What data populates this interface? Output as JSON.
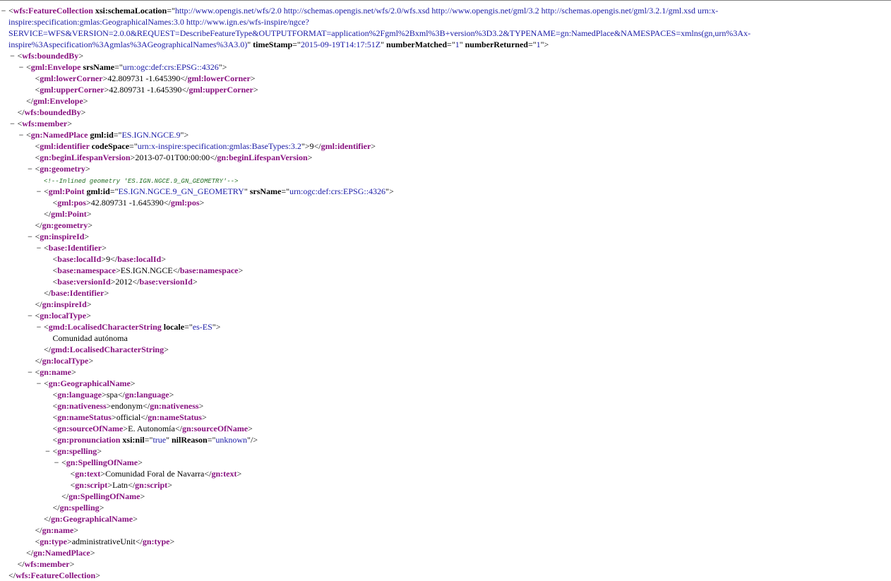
{
  "toggle_symbol": "−",
  "colors": {
    "tag": "#881280",
    "attr_value": "#1a1aa6",
    "comment": "#236e25",
    "text": "#000000"
  },
  "lines": [
    {
      "d": 0,
      "toggle": true,
      "wrap": true,
      "parts": [
        {
          "k": "lt",
          "t": "<"
        },
        {
          "k": "tag",
          "t": "wfs:FeatureCollection"
        },
        {
          "k": "an",
          "t": " xsi:schemaLocation"
        },
        {
          "k": "p",
          "t": "=\""
        },
        {
          "k": "av",
          "t": "http://www.opengis.net/wfs/2.0 http://schemas.opengis.net/wfs/2.0/wfs.xsd http://www.opengis.net/gml/3.2 http://schemas.opengis.net/gml/3.2.1/gml.xsd urn:x-inspire:specification:gmlas:GeographicalNames:3.0 http://www.ign.es/wfs-inspire/ngce?SERVICE=WFS&VERSION=2.0.0&REQUEST=DescribeFeatureType&OUTPUTFORMAT=application%2Fgml%2Bxml%3B+version%3D3.2&TYPENAME=gn:NamedPlace&NAMESPACES=xmlns(gn,urn%3Ax-inspire%3Aspecification%3Agmlas%3AGeographicalNames%3A3.0)"
        },
        {
          "k": "p",
          "t": "\""
        },
        {
          "k": "an",
          "t": " timeStamp"
        },
        {
          "k": "p",
          "t": "=\""
        },
        {
          "k": "av",
          "t": "2015-09-19T14:17:51Z"
        },
        {
          "k": "p",
          "t": "\""
        },
        {
          "k": "an",
          "t": " numberMatched"
        },
        {
          "k": "p",
          "t": "=\""
        },
        {
          "k": "av",
          "t": "1"
        },
        {
          "k": "p",
          "t": "\""
        },
        {
          "k": "an",
          "t": " numberReturned"
        },
        {
          "k": "p",
          "t": "=\""
        },
        {
          "k": "av",
          "t": "1"
        },
        {
          "k": "p",
          "t": "\""
        },
        {
          "k": "lt",
          "t": ">"
        }
      ]
    },
    {
      "d": 1,
      "toggle": true,
      "parts": [
        {
          "k": "lt",
          "t": "<"
        },
        {
          "k": "tag",
          "t": "wfs:boundedBy"
        },
        {
          "k": "lt",
          "t": ">"
        }
      ]
    },
    {
      "d": 2,
      "toggle": true,
      "parts": [
        {
          "k": "lt",
          "t": "<"
        },
        {
          "k": "tag",
          "t": "gml:Envelope"
        },
        {
          "k": "an",
          "t": " srsName"
        },
        {
          "k": "p",
          "t": "=\""
        },
        {
          "k": "av",
          "t": "urn:ogc:def:crs:EPSG::4326"
        },
        {
          "k": "p",
          "t": "\""
        },
        {
          "k": "lt",
          "t": ">"
        }
      ]
    },
    {
      "d": 3,
      "parts": [
        {
          "k": "lt",
          "t": "<"
        },
        {
          "k": "tag",
          "t": "gml:lowerCorner"
        },
        {
          "k": "lt",
          "t": ">"
        },
        {
          "k": "txt",
          "t": "42.809731 -1.645390"
        },
        {
          "k": "lt",
          "t": "</"
        },
        {
          "k": "tag",
          "t": "gml:lowerCorner"
        },
        {
          "k": "lt",
          "t": ">"
        }
      ]
    },
    {
      "d": 3,
      "parts": [
        {
          "k": "lt",
          "t": "<"
        },
        {
          "k": "tag",
          "t": "gml:upperCorner"
        },
        {
          "k": "lt",
          "t": ">"
        },
        {
          "k": "txt",
          "t": "42.809731 -1.645390"
        },
        {
          "k": "lt",
          "t": "</"
        },
        {
          "k": "tag",
          "t": "gml:upperCorner"
        },
        {
          "k": "lt",
          "t": ">"
        }
      ]
    },
    {
      "d": 2,
      "parts": [
        {
          "k": "lt",
          "t": "</"
        },
        {
          "k": "tag",
          "t": "gml:Envelope"
        },
        {
          "k": "lt",
          "t": ">"
        }
      ]
    },
    {
      "d": 1,
      "parts": [
        {
          "k": "lt",
          "t": "</"
        },
        {
          "k": "tag",
          "t": "wfs:boundedBy"
        },
        {
          "k": "lt",
          "t": ">"
        }
      ]
    },
    {
      "d": 1,
      "toggle": true,
      "parts": [
        {
          "k": "lt",
          "t": "<"
        },
        {
          "k": "tag",
          "t": "wfs:member"
        },
        {
          "k": "lt",
          "t": ">"
        }
      ]
    },
    {
      "d": 2,
      "toggle": true,
      "parts": [
        {
          "k": "lt",
          "t": "<"
        },
        {
          "k": "tag",
          "t": "gn:NamedPlace"
        },
        {
          "k": "an",
          "t": " gml:id"
        },
        {
          "k": "p",
          "t": "=\""
        },
        {
          "k": "av",
          "t": "ES.IGN.NGCE.9"
        },
        {
          "k": "p",
          "t": "\""
        },
        {
          "k": "lt",
          "t": ">"
        }
      ]
    },
    {
      "d": 3,
      "parts": [
        {
          "k": "lt",
          "t": "<"
        },
        {
          "k": "tag",
          "t": "gml:identifier"
        },
        {
          "k": "an",
          "t": " codeSpace"
        },
        {
          "k": "p",
          "t": "=\""
        },
        {
          "k": "av",
          "t": "urn:x-inspire:specification:gmlas:BaseTypes:3.2"
        },
        {
          "k": "p",
          "t": "\""
        },
        {
          "k": "lt",
          "t": ">"
        },
        {
          "k": "txt",
          "t": "9"
        },
        {
          "k": "lt",
          "t": "</"
        },
        {
          "k": "tag",
          "t": "gml:identifier"
        },
        {
          "k": "lt",
          "t": ">"
        }
      ]
    },
    {
      "d": 3,
      "parts": [
        {
          "k": "lt",
          "t": "<"
        },
        {
          "k": "tag",
          "t": "gn:beginLifespanVersion"
        },
        {
          "k": "lt",
          "t": ">"
        },
        {
          "k": "txt",
          "t": "2013-07-01T00:00:00"
        },
        {
          "k": "lt",
          "t": "</"
        },
        {
          "k": "tag",
          "t": "gn:beginLifespanVersion"
        },
        {
          "k": "lt",
          "t": ">"
        }
      ]
    },
    {
      "d": 3,
      "toggle": true,
      "parts": [
        {
          "k": "lt",
          "t": "<"
        },
        {
          "k": "tag",
          "t": "gn:geometry"
        },
        {
          "k": "lt",
          "t": ">"
        }
      ]
    },
    {
      "d": 4,
      "parts": [
        {
          "k": "com",
          "t": "<!--Inlined geometry 'ES.IGN.NGCE.9_GN_GEOMETRY'-->"
        }
      ]
    },
    {
      "d": 4,
      "toggle": true,
      "parts": [
        {
          "k": "lt",
          "t": "<"
        },
        {
          "k": "tag",
          "t": "gml:Point"
        },
        {
          "k": "an",
          "t": " gml:id"
        },
        {
          "k": "p",
          "t": "=\""
        },
        {
          "k": "av",
          "t": "ES.IGN.NGCE.9_GN_GEOMETRY"
        },
        {
          "k": "p",
          "t": "\""
        },
        {
          "k": "an",
          "t": " srsName"
        },
        {
          "k": "p",
          "t": "=\""
        },
        {
          "k": "av",
          "t": "urn:ogc:def:crs:EPSG::4326"
        },
        {
          "k": "p",
          "t": "\""
        },
        {
          "k": "lt",
          "t": ">"
        }
      ]
    },
    {
      "d": 5,
      "parts": [
        {
          "k": "lt",
          "t": "<"
        },
        {
          "k": "tag",
          "t": "gml:pos"
        },
        {
          "k": "lt",
          "t": ">"
        },
        {
          "k": "txt",
          "t": "42.809731 -1.645390"
        },
        {
          "k": "lt",
          "t": "</"
        },
        {
          "k": "tag",
          "t": "gml:pos"
        },
        {
          "k": "lt",
          "t": ">"
        }
      ]
    },
    {
      "d": 4,
      "parts": [
        {
          "k": "lt",
          "t": "</"
        },
        {
          "k": "tag",
          "t": "gml:Point"
        },
        {
          "k": "lt",
          "t": ">"
        }
      ]
    },
    {
      "d": 3,
      "parts": [
        {
          "k": "lt",
          "t": "</"
        },
        {
          "k": "tag",
          "t": "gn:geometry"
        },
        {
          "k": "lt",
          "t": ">"
        }
      ]
    },
    {
      "d": 3,
      "toggle": true,
      "parts": [
        {
          "k": "lt",
          "t": "<"
        },
        {
          "k": "tag",
          "t": "gn:inspireId"
        },
        {
          "k": "lt",
          "t": ">"
        }
      ]
    },
    {
      "d": 4,
      "toggle": true,
      "parts": [
        {
          "k": "lt",
          "t": "<"
        },
        {
          "k": "tag",
          "t": "base:Identifier"
        },
        {
          "k": "lt",
          "t": ">"
        }
      ]
    },
    {
      "d": 5,
      "parts": [
        {
          "k": "lt",
          "t": "<"
        },
        {
          "k": "tag",
          "t": "base:localId"
        },
        {
          "k": "lt",
          "t": ">"
        },
        {
          "k": "txt",
          "t": "9"
        },
        {
          "k": "lt",
          "t": "</"
        },
        {
          "k": "tag",
          "t": "base:localId"
        },
        {
          "k": "lt",
          "t": ">"
        }
      ]
    },
    {
      "d": 5,
      "parts": [
        {
          "k": "lt",
          "t": "<"
        },
        {
          "k": "tag",
          "t": "base:namespace"
        },
        {
          "k": "lt",
          "t": ">"
        },
        {
          "k": "txt",
          "t": "ES.IGN.NGCE"
        },
        {
          "k": "lt",
          "t": "</"
        },
        {
          "k": "tag",
          "t": "base:namespace"
        },
        {
          "k": "lt",
          "t": ">"
        }
      ]
    },
    {
      "d": 5,
      "parts": [
        {
          "k": "lt",
          "t": "<"
        },
        {
          "k": "tag",
          "t": "base:versionId"
        },
        {
          "k": "lt",
          "t": ">"
        },
        {
          "k": "txt",
          "t": "2012"
        },
        {
          "k": "lt",
          "t": "</"
        },
        {
          "k": "tag",
          "t": "base:versionId"
        },
        {
          "k": "lt",
          "t": ">"
        }
      ]
    },
    {
      "d": 4,
      "parts": [
        {
          "k": "lt",
          "t": "</"
        },
        {
          "k": "tag",
          "t": "base:Identifier"
        },
        {
          "k": "lt",
          "t": ">"
        }
      ]
    },
    {
      "d": 3,
      "parts": [
        {
          "k": "lt",
          "t": "</"
        },
        {
          "k": "tag",
          "t": "gn:inspireId"
        },
        {
          "k": "lt",
          "t": ">"
        }
      ]
    },
    {
      "d": 3,
      "toggle": true,
      "parts": [
        {
          "k": "lt",
          "t": "<"
        },
        {
          "k": "tag",
          "t": "gn:localType"
        },
        {
          "k": "lt",
          "t": ">"
        }
      ]
    },
    {
      "d": 4,
      "toggle": true,
      "parts": [
        {
          "k": "lt",
          "t": "<"
        },
        {
          "k": "tag",
          "t": "gmd:LocalisedCharacterString"
        },
        {
          "k": "an",
          "t": " locale"
        },
        {
          "k": "p",
          "t": "=\""
        },
        {
          "k": "av",
          "t": "es-ES"
        },
        {
          "k": "p",
          "t": "\""
        },
        {
          "k": "lt",
          "t": ">"
        }
      ]
    },
    {
      "d": 5,
      "parts": [
        {
          "k": "txt",
          "t": "Comunidad autónoma"
        }
      ]
    },
    {
      "d": 4,
      "parts": [
        {
          "k": "lt",
          "t": "</"
        },
        {
          "k": "tag",
          "t": "gmd:LocalisedCharacterString"
        },
        {
          "k": "lt",
          "t": ">"
        }
      ]
    },
    {
      "d": 3,
      "parts": [
        {
          "k": "lt",
          "t": "</"
        },
        {
          "k": "tag",
          "t": "gn:localType"
        },
        {
          "k": "lt",
          "t": ">"
        }
      ]
    },
    {
      "d": 3,
      "toggle": true,
      "parts": [
        {
          "k": "lt",
          "t": "<"
        },
        {
          "k": "tag",
          "t": "gn:name"
        },
        {
          "k": "lt",
          "t": ">"
        }
      ]
    },
    {
      "d": 4,
      "toggle": true,
      "parts": [
        {
          "k": "lt",
          "t": "<"
        },
        {
          "k": "tag",
          "t": "gn:GeographicalName"
        },
        {
          "k": "lt",
          "t": ">"
        }
      ]
    },
    {
      "d": 5,
      "parts": [
        {
          "k": "lt",
          "t": "<"
        },
        {
          "k": "tag",
          "t": "gn:language"
        },
        {
          "k": "lt",
          "t": ">"
        },
        {
          "k": "txt",
          "t": "spa"
        },
        {
          "k": "lt",
          "t": "</"
        },
        {
          "k": "tag",
          "t": "gn:language"
        },
        {
          "k": "lt",
          "t": ">"
        }
      ]
    },
    {
      "d": 5,
      "parts": [
        {
          "k": "lt",
          "t": "<"
        },
        {
          "k": "tag",
          "t": "gn:nativeness"
        },
        {
          "k": "lt",
          "t": ">"
        },
        {
          "k": "txt",
          "t": "endonym"
        },
        {
          "k": "lt",
          "t": "</"
        },
        {
          "k": "tag",
          "t": "gn:nativeness"
        },
        {
          "k": "lt",
          "t": ">"
        }
      ]
    },
    {
      "d": 5,
      "parts": [
        {
          "k": "lt",
          "t": "<"
        },
        {
          "k": "tag",
          "t": "gn:nameStatus"
        },
        {
          "k": "lt",
          "t": ">"
        },
        {
          "k": "txt",
          "t": "official"
        },
        {
          "k": "lt",
          "t": "</"
        },
        {
          "k": "tag",
          "t": "gn:nameStatus"
        },
        {
          "k": "lt",
          "t": ">"
        }
      ]
    },
    {
      "d": 5,
      "parts": [
        {
          "k": "lt",
          "t": "<"
        },
        {
          "k": "tag",
          "t": "gn:sourceOfName"
        },
        {
          "k": "lt",
          "t": ">"
        },
        {
          "k": "txt",
          "t": "E. Autonomía"
        },
        {
          "k": "lt",
          "t": "</"
        },
        {
          "k": "tag",
          "t": "gn:sourceOfName"
        },
        {
          "k": "lt",
          "t": ">"
        }
      ]
    },
    {
      "d": 5,
      "parts": [
        {
          "k": "lt",
          "t": "<"
        },
        {
          "k": "tag",
          "t": "gn:pronunciation"
        },
        {
          "k": "an",
          "t": " xsi:nil"
        },
        {
          "k": "p",
          "t": "=\""
        },
        {
          "k": "av",
          "t": "true"
        },
        {
          "k": "p",
          "t": "\""
        },
        {
          "k": "an",
          "t": " nilReason"
        },
        {
          "k": "p",
          "t": "=\""
        },
        {
          "k": "av",
          "t": "unknown"
        },
        {
          "k": "p",
          "t": "\""
        },
        {
          "k": "lt",
          "t": "/>"
        }
      ]
    },
    {
      "d": 5,
      "toggle": true,
      "parts": [
        {
          "k": "lt",
          "t": "<"
        },
        {
          "k": "tag",
          "t": "gn:spelling"
        },
        {
          "k": "lt",
          "t": ">"
        }
      ]
    },
    {
      "d": 6,
      "toggle": true,
      "parts": [
        {
          "k": "lt",
          "t": "<"
        },
        {
          "k": "tag",
          "t": "gn:SpellingOfName"
        },
        {
          "k": "lt",
          "t": ">"
        }
      ]
    },
    {
      "d": 7,
      "parts": [
        {
          "k": "lt",
          "t": "<"
        },
        {
          "k": "tag",
          "t": "gn:text"
        },
        {
          "k": "lt",
          "t": ">"
        },
        {
          "k": "txt",
          "t": "Comunidad Foral de Navarra"
        },
        {
          "k": "lt",
          "t": "</"
        },
        {
          "k": "tag",
          "t": "gn:text"
        },
        {
          "k": "lt",
          "t": ">"
        }
      ]
    },
    {
      "d": 7,
      "parts": [
        {
          "k": "lt",
          "t": "<"
        },
        {
          "k": "tag",
          "t": "gn:script"
        },
        {
          "k": "lt",
          "t": ">"
        },
        {
          "k": "txt",
          "t": "Latn"
        },
        {
          "k": "lt",
          "t": "</"
        },
        {
          "k": "tag",
          "t": "gn:script"
        },
        {
          "k": "lt",
          "t": ">"
        }
      ]
    },
    {
      "d": 6,
      "parts": [
        {
          "k": "lt",
          "t": "</"
        },
        {
          "k": "tag",
          "t": "gn:SpellingOfName"
        },
        {
          "k": "lt",
          "t": ">"
        }
      ]
    },
    {
      "d": 5,
      "parts": [
        {
          "k": "lt",
          "t": "</"
        },
        {
          "k": "tag",
          "t": "gn:spelling"
        },
        {
          "k": "lt",
          "t": ">"
        }
      ]
    },
    {
      "d": 4,
      "parts": [
        {
          "k": "lt",
          "t": "</"
        },
        {
          "k": "tag",
          "t": "gn:GeographicalName"
        },
        {
          "k": "lt",
          "t": ">"
        }
      ]
    },
    {
      "d": 3,
      "parts": [
        {
          "k": "lt",
          "t": "</"
        },
        {
          "k": "tag",
          "t": "gn:name"
        },
        {
          "k": "lt",
          "t": ">"
        }
      ]
    },
    {
      "d": 3,
      "parts": [
        {
          "k": "lt",
          "t": "<"
        },
        {
          "k": "tag",
          "t": "gn:type"
        },
        {
          "k": "lt",
          "t": ">"
        },
        {
          "k": "txt",
          "t": "administrativeUnit"
        },
        {
          "k": "lt",
          "t": "</"
        },
        {
          "k": "tag",
          "t": "gn:type"
        },
        {
          "k": "lt",
          "t": ">"
        }
      ]
    },
    {
      "d": 2,
      "parts": [
        {
          "k": "lt",
          "t": "</"
        },
        {
          "k": "tag",
          "t": "gn:NamedPlace"
        },
        {
          "k": "lt",
          "t": ">"
        }
      ]
    },
    {
      "d": 1,
      "parts": [
        {
          "k": "lt",
          "t": "</"
        },
        {
          "k": "tag",
          "t": "wfs:member"
        },
        {
          "k": "lt",
          "t": ">"
        }
      ]
    },
    {
      "d": 0,
      "parts": [
        {
          "k": "lt",
          "t": "</"
        },
        {
          "k": "tag",
          "t": "wfs:FeatureCollection"
        },
        {
          "k": "lt",
          "t": ">"
        }
      ]
    }
  ]
}
